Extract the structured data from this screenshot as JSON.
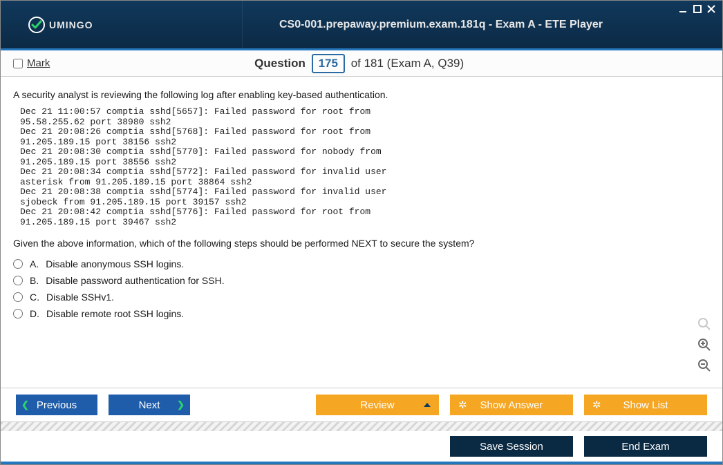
{
  "window": {
    "brand": "UMINGO",
    "title": "CS0-001.prepaway.premium.exam.181q - Exam A - ETE Player"
  },
  "toprow": {
    "mark_label": "Mark",
    "question_word": "Question",
    "question_num": "175",
    "of_text": "of 181 (Exam A, Q39)"
  },
  "question": {
    "intro": "A security analyst is reviewing the following log after enabling key-based authentication.",
    "log": "Dec 21 11:00:57 comptia sshd[5657]: Failed password for root from\n95.58.255.62 port 38980 ssh2\nDec 21 20:08:26 comptia sshd[5768]: Failed password for root from\n91.205.189.15 port 38156 ssh2\nDec 21 20:08:30 comptia sshd[5770]: Failed password for nobody from\n91.205.189.15 port 38556 ssh2\nDec 21 20:08:34 comptia sshd[5772]: Failed password for invalid user\nasterisk from 91.205.189.15 port 38864 ssh2\nDec 21 20:08:38 comptia sshd[5774]: Failed password for invalid user\nsjobeck from 91.205.189.15 port 39157 ssh2\nDec 21 20:08:42 comptia sshd[5776]: Failed password for root from\n91.205.189.15 port 39467 ssh2",
    "prompt": "Given the above information, which of the following steps should be performed NEXT to secure the system?",
    "answers": [
      {
        "letter": "A.",
        "text": "Disable anonymous SSH logins."
      },
      {
        "letter": "B.",
        "text": "Disable password authentication for SSH."
      },
      {
        "letter": "C.",
        "text": "Disable SSHv1."
      },
      {
        "letter": "D.",
        "text": "Disable remote root SSH logins."
      }
    ]
  },
  "footer": {
    "previous": "Previous",
    "next": "Next",
    "review": "Review",
    "show_answer": "Show Answer",
    "show_list": "Show List",
    "save_session": "Save Session",
    "end_exam": "End Exam"
  }
}
